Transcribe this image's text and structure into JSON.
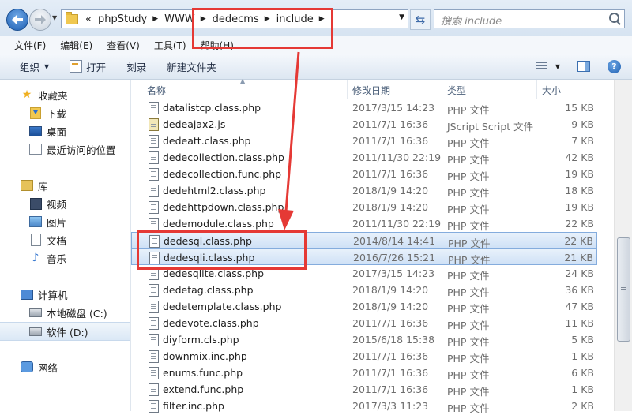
{
  "address": {
    "crumbs": [
      "«",
      "phpStudy",
      "WWW",
      "dedecms",
      "include"
    ],
    "search_placeholder": "搜索 include"
  },
  "menu": [
    "文件(F)",
    "编辑(E)",
    "查看(V)",
    "工具(T)",
    "帮助(H)"
  ],
  "toolbar": {
    "organize": "组织",
    "open": "打开",
    "burn": "刻录",
    "new_folder": "新建文件夹"
  },
  "nav": {
    "favorites": "收藏夹",
    "downloads": "下载",
    "desktop": "桌面",
    "recent": "最近访问的位置",
    "libraries": "库",
    "videos": "视频",
    "pictures": "图片",
    "documents": "文档",
    "music": "音乐",
    "computer": "计算机",
    "local_disk": "本地磁盘 (C:)",
    "software_disk": "软件 (D:)",
    "network": "网络"
  },
  "columns": {
    "name": "名称",
    "date": "修改日期",
    "type": "类型",
    "size": "大小"
  },
  "files": [
    {
      "name": "datalistcp.class.php",
      "date": "2017/3/15 14:23",
      "type": "PHP 文件",
      "size": "15 KB",
      "selected": false,
      "icon": "php-file-icon"
    },
    {
      "name": "dedeajax2.js",
      "date": "2011/7/1 16:36",
      "type": "JScript Script 文件",
      "size": "9 KB",
      "selected": false,
      "icon": "js-file-icon"
    },
    {
      "name": "dedeatt.class.php",
      "date": "2011/7/1 16:36",
      "type": "PHP 文件",
      "size": "7 KB",
      "selected": false,
      "icon": "php-file-icon"
    },
    {
      "name": "dedecollection.class.php",
      "date": "2011/11/30 22:19",
      "type": "PHP 文件",
      "size": "42 KB",
      "selected": false,
      "icon": "php-file-icon"
    },
    {
      "name": "dedecollection.func.php",
      "date": "2011/7/1 16:36",
      "type": "PHP 文件",
      "size": "19 KB",
      "selected": false,
      "icon": "php-file-icon"
    },
    {
      "name": "dedehtml2.class.php",
      "date": "2018/1/9 14:20",
      "type": "PHP 文件",
      "size": "18 KB",
      "selected": false,
      "icon": "php-file-icon"
    },
    {
      "name": "dedehttpdown.class.php",
      "date": "2018/1/9 14:20",
      "type": "PHP 文件",
      "size": "19 KB",
      "selected": false,
      "icon": "php-file-icon"
    },
    {
      "name": "dedemodule.class.php",
      "date": "2011/11/30 22:19",
      "type": "PHP 文件",
      "size": "22 KB",
      "selected": false,
      "icon": "php-file-icon"
    },
    {
      "name": "dedesql.class.php",
      "date": "2014/8/14 14:41",
      "type": "PHP 文件",
      "size": "22 KB",
      "selected": true,
      "icon": "php-file-icon"
    },
    {
      "name": "dedesqli.class.php",
      "date": "2016/7/26 15:21",
      "type": "PHP 文件",
      "size": "21 KB",
      "selected": true,
      "icon": "php-file-icon"
    },
    {
      "name": "dedesqlite.class.php",
      "date": "2017/3/15 14:23",
      "type": "PHP 文件",
      "size": "24 KB",
      "selected": false,
      "icon": "php-file-icon"
    },
    {
      "name": "dedetag.class.php",
      "date": "2018/1/9 14:20",
      "type": "PHP 文件",
      "size": "36 KB",
      "selected": false,
      "icon": "php-file-icon"
    },
    {
      "name": "dedetemplate.class.php",
      "date": "2018/1/9 14:20",
      "type": "PHP 文件",
      "size": "47 KB",
      "selected": false,
      "icon": "php-file-icon"
    },
    {
      "name": "dedevote.class.php",
      "date": "2011/7/1 16:36",
      "type": "PHP 文件",
      "size": "11 KB",
      "selected": false,
      "icon": "php-file-icon"
    },
    {
      "name": "diyform.cls.php",
      "date": "2015/6/18 15:38",
      "type": "PHP 文件",
      "size": "5 KB",
      "selected": false,
      "icon": "php-file-icon"
    },
    {
      "name": "downmix.inc.php",
      "date": "2011/7/1 16:36",
      "type": "PHP 文件",
      "size": "1 KB",
      "selected": false,
      "icon": "php-file-icon"
    },
    {
      "name": "enums.func.php",
      "date": "2011/7/1 16:36",
      "type": "PHP 文件",
      "size": "6 KB",
      "selected": false,
      "icon": "php-file-icon"
    },
    {
      "name": "extend.func.php",
      "date": "2011/7/1 16:36",
      "type": "PHP 文件",
      "size": "1 KB",
      "selected": false,
      "icon": "php-file-icon"
    },
    {
      "name": "filter.inc.php",
      "date": "2017/3/3 11:23",
      "type": "PHP 文件",
      "size": "2 KB",
      "selected": false,
      "icon": "php-file-icon"
    }
  ],
  "colors": {
    "annotation": "#e53935",
    "selection": "#cfe1f6"
  }
}
